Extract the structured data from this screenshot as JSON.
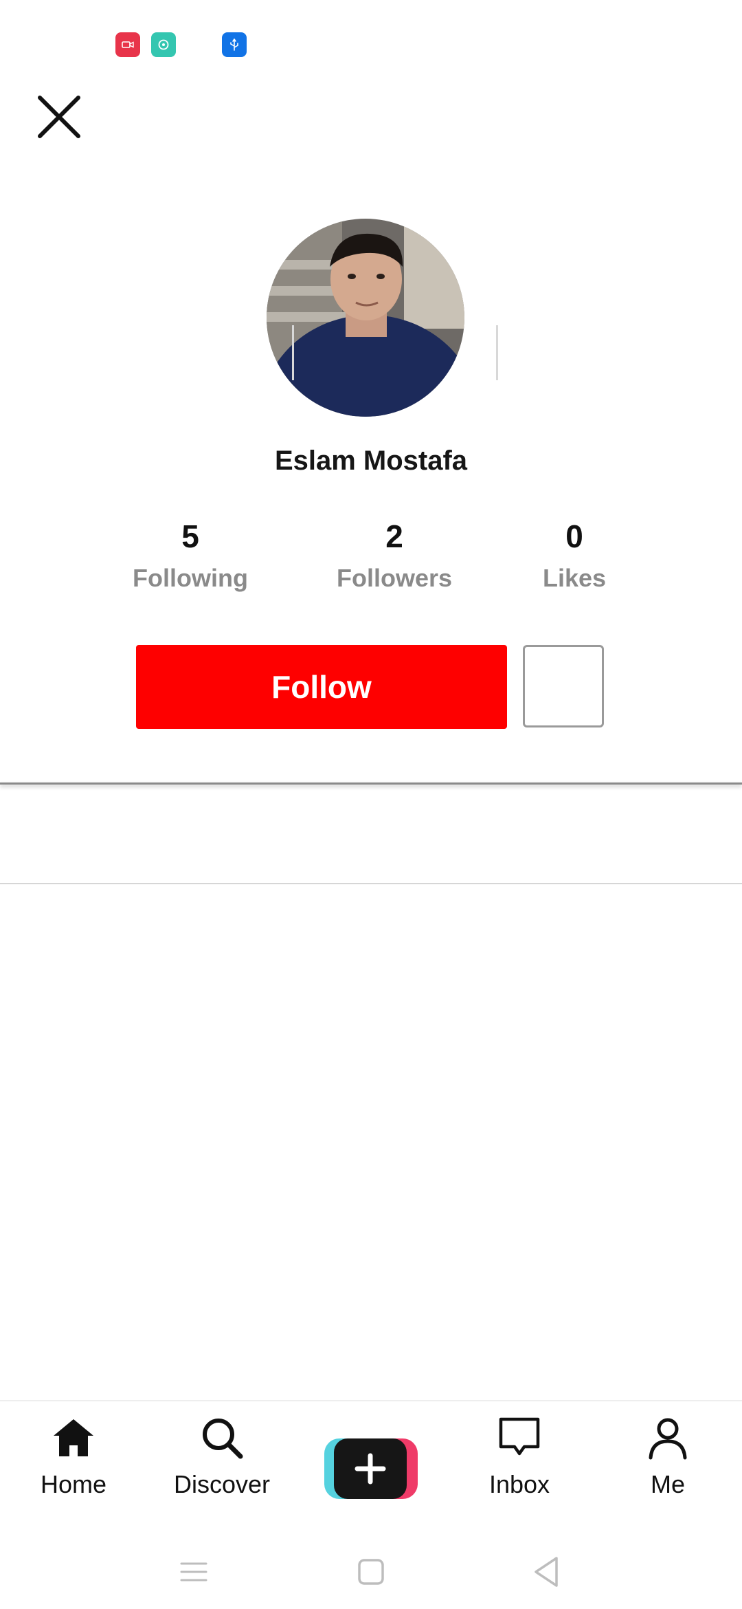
{
  "status_bar": {
    "icons": [
      {
        "name": "screen-record-icon",
        "color": "#e8344a"
      },
      {
        "name": "chat-bubble-icon",
        "color": "#34c6b0"
      },
      {
        "name": "usb-icon",
        "color": "#1173e6"
      }
    ]
  },
  "profile": {
    "username": "Eslam Mostafa",
    "stats": [
      {
        "value": "5",
        "label": "Following"
      },
      {
        "value": "2",
        "label": "Followers"
      },
      {
        "value": "0",
        "label": "Likes"
      }
    ],
    "follow_label": "Follow"
  },
  "bottom_nav": {
    "items": [
      {
        "label": "Home",
        "icon": "home-icon"
      },
      {
        "label": "Discover",
        "icon": "search-icon"
      },
      {
        "label": "",
        "icon": "plus-icon"
      },
      {
        "label": "Inbox",
        "icon": "inbox-icon"
      },
      {
        "label": "Me",
        "icon": "profile-icon"
      }
    ]
  },
  "colors": {
    "follow_button": "#fe0000",
    "create_cyan": "#55d2df",
    "create_pink": "#ef3b68"
  }
}
